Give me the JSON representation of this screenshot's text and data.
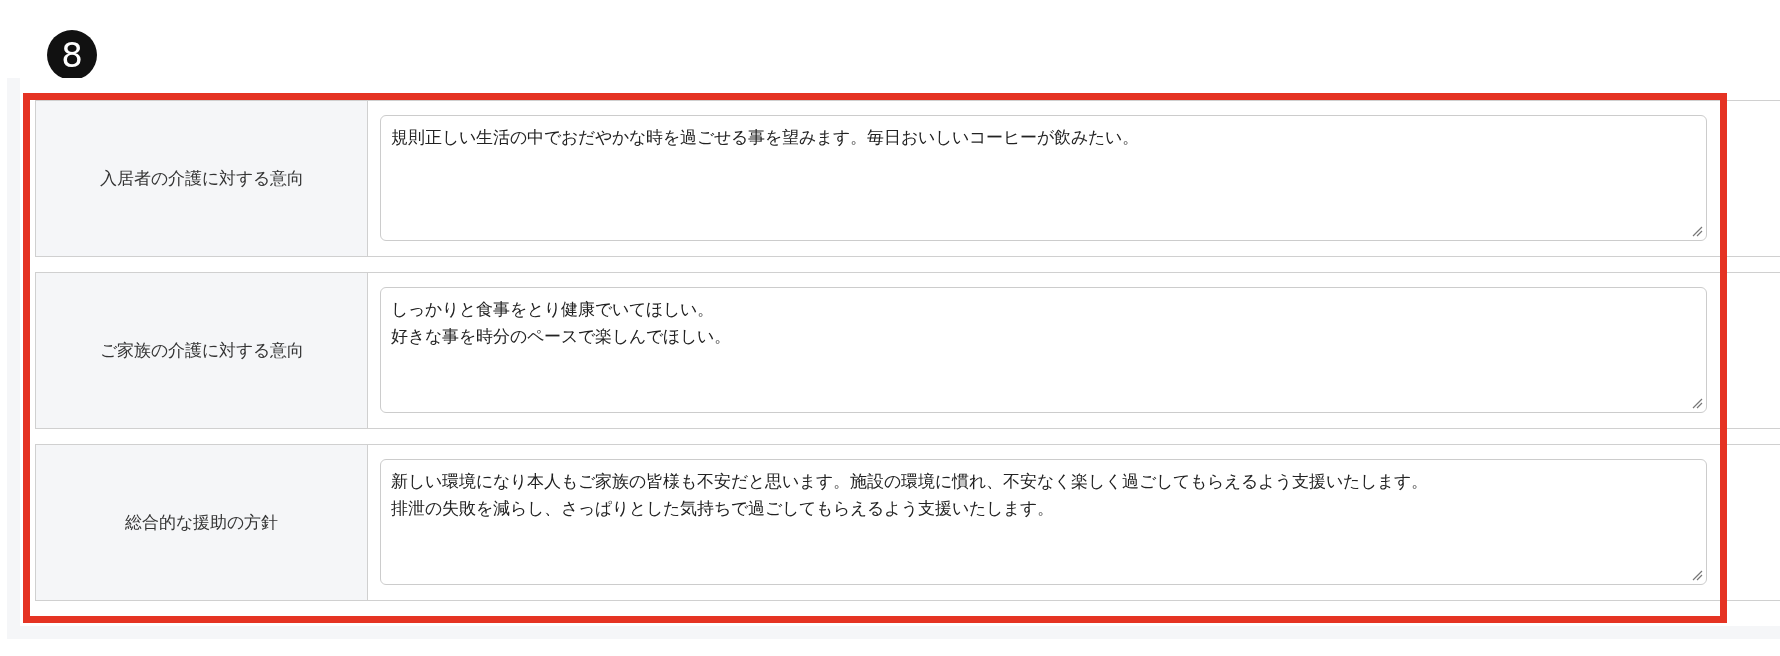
{
  "step_badge": "8",
  "highlighted": true,
  "rows": [
    {
      "label": "入居者の介護に対する意向",
      "lines": [
        "規則正しい生活の中でおだやかな時を過ごせる事を望みます。毎日おいしいコーヒーが飲みたい。"
      ]
    },
    {
      "label": "ご家族の介護に対する意向",
      "lines": [
        "しっかりと食事をとり健康でいてほしい。",
        "好きな事を時分のペースで楽しんでほしい。"
      ]
    },
    {
      "label": "総合的な援助の方針",
      "lines": [
        "新しい環境になり本人もご家族の皆様も不安だと思います。施設の環境に慣れ、不安なく楽しく過ごしてもらえるよう支援いたします。",
        "排泄の失敗を減らし、さっぱりとした気持ちで過ごしてもらえるよう支援いたします。"
      ]
    }
  ]
}
